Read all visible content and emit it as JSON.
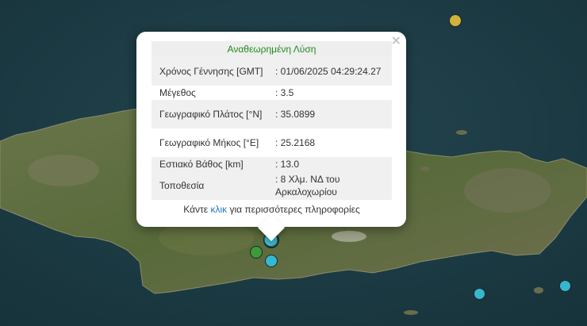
{
  "popup": {
    "title": "Αναθεωρημένη Λύση",
    "close_glyph": "×",
    "rows": [
      {
        "label": "Χρόνος Γέννησης [GMT]",
        "value": ": 01/06/2025 04:29:24.27"
      },
      {
        "label": "Μέγεθος",
        "value": ": 3.5"
      },
      {
        "label": "Γεωγραφικό Πλάτος [°N]",
        "value": ": 35.0899"
      },
      {
        "label": "Γεωγραφικό Μήκος [°E]",
        "value": ": 25.2168"
      },
      {
        "label": "Εστιακό Βάθος [km]",
        "value": ": 13.0"
      },
      {
        "label": "Τοποθεσία",
        "value": ": 8 Χλμ. ΝΔ του Αρκαλοχωρίου"
      }
    ],
    "footer_before": "Κάντε",
    "footer_link": "κλικ",
    "footer_after": "για περισσότερες πληροφορίες"
  },
  "markers": [
    {
      "name": "marker-yellow",
      "color": "#d4b23a"
    },
    {
      "name": "marker-selected",
      "color": "#4fc6da"
    },
    {
      "name": "marker-cyan-1",
      "color": "#35b8cf"
    },
    {
      "name": "marker-green",
      "color": "#3f9a3a"
    },
    {
      "name": "marker-cyan-2",
      "color": "#35b8cf"
    },
    {
      "name": "marker-cyan-3",
      "color": "#35b8cf"
    },
    {
      "name": "marker-cyan-4",
      "color": "#35b8cf"
    }
  ],
  "colors": {
    "sea": "#1c3a43",
    "land": "#5b6a3c",
    "title_text": "#1f8a1f",
    "link": "#1d7dbf"
  }
}
